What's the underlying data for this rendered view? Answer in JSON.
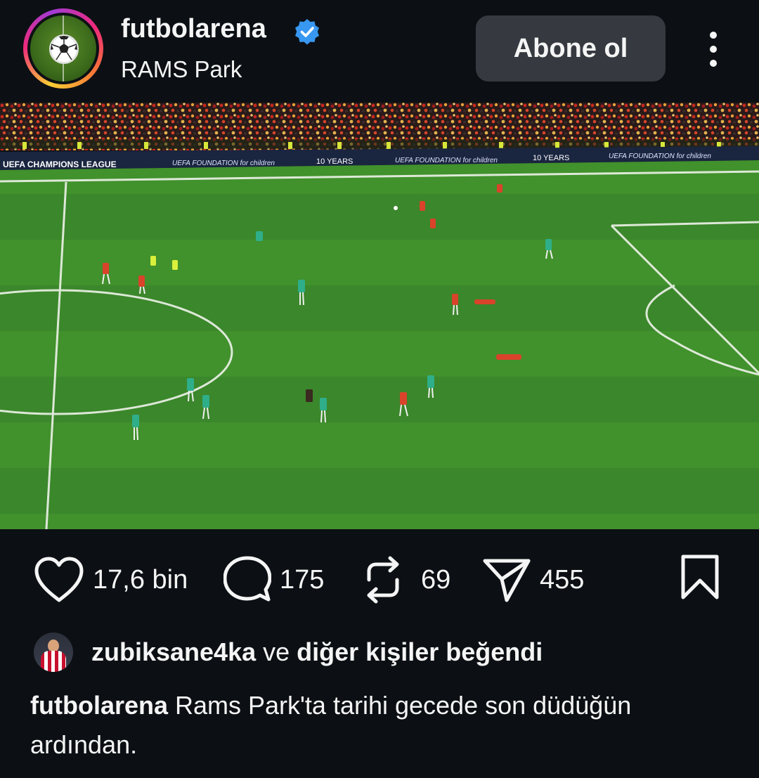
{
  "post": {
    "username": "futbolarena",
    "location": "RAMS Park",
    "follow_label": "Abone ol",
    "icons": {
      "verified": "verified-badge-icon",
      "more": "more-options-icon"
    },
    "colors": {
      "background": "#0c1014",
      "verified": "#3897f0",
      "follow_button": "#363a40"
    }
  },
  "photo": {
    "ad_boards": [
      "UEFA CHAMPIONS LEAGUE",
      "UEFA FOUNDATION for children",
      "10 YEARS",
      "UEFA FOUNDATION for children",
      "10 YEARS",
      "UEFA FOUNDATION for children"
    ]
  },
  "actions": {
    "like_count": "17,6 bin",
    "comment_count": "175",
    "repost_count": "69",
    "share_count": "455"
  },
  "likes": {
    "liker": "zubiksane4ka",
    "suffix_plain": " ve ",
    "suffix_bold": "diğer kişiler beğendi"
  },
  "caption": {
    "author": "futbolarena",
    "text": " Rams Park'ta tarihi gecede son düdüğün ardından."
  }
}
